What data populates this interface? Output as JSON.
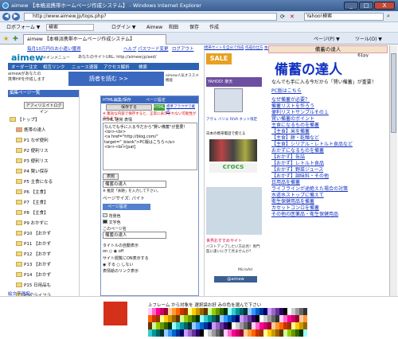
{
  "window": {
    "title": "aimew 【本格派携帯ホームページ作成システム】 - Windows Internet Explorer",
    "minimize": "_",
    "maximize": "□",
    "close": "X"
  },
  "address": {
    "url": "http://www.aimew.jp/tops.php?",
    "search_placeholder": "Yahoo!検索"
  },
  "favorites": {
    "items": [
      "ロボフォーム ▼",
      "検索",
      "ログイン ▼",
      "Aimew",
      "和田",
      "保存",
      "作成"
    ]
  },
  "tab": {
    "label": "aimew 【本格派携帯ホームページ作成システム】",
    "commands": [
      "ページ(P) ▼",
      "ツール(O) ▼"
    ]
  },
  "left": {
    "top_link": "毎月10万円のお小遣い獲得",
    "header_links": [
      "ヘルプ",
      "パスワード変更",
      "ログアウト"
    ],
    "account_label": "あなたのサイトURL: http://aimew.jp/aed/",
    "logo": "aimew",
    "logo_sub": "メインメニュー",
    "nav": [
      "オーダー注文",
      "相互リンク",
      "ニュース速報",
      "アクセス解析",
      "検索"
    ],
    "promo_lines": [
      "aimewがあなたの",
      "携帯HPを作成します"
    ],
    "promo_main": "読者を読む >>",
    "promo_tag": "aimew人気オススメ機能",
    "sidebar_title": "編集ページ一覧",
    "affiliate_button": "アフィリエイトログイン",
    "tree": [
      "【トップ】",
      "携帯の達人",
      "P1 なぜ便利",
      "P2 便利リス",
      "P3 便利リス",
      "P4 賢い保存",
      "P5 主食になる",
      "P6 【主食】",
      "P7 【主食】",
      "P8 【主食】",
      "P9 おかずに",
      "P10 【おかず",
      "P11 【おかず",
      "P12 【おかず",
      "P13 【おかず",
      "P14 【おかず",
      "P15 日用品も",
      "P16 ライフラ"
    ],
    "footer_link": "絵文字選択へ"
  },
  "editor": {
    "tabs": [
      "HTML編集/保存",
      "ページ設定",
      "ページ"
    ],
    "save_button": "保存する",
    "html_toggle": "HTML",
    "preview_btn": "標準ブラウザで確認",
    "warning": "※ 無効な内容で保存すると、正常に表示されない可能性があります。",
    "radio_label": "HTML 通常 表情",
    "content": "なんでも手に入る今だから\"賢い備蓄\"が重要！\n<br><br>\n<a href=\"http://blog.com/\" target=\"_blank\">PC版はこちら</a>\n<br><br>[pat]",
    "title_label": "表題",
    "title_value": "備蓄の達人",
    "note": "※ 推奨「表題」を入力して下さい。",
    "size_label": "ページサイズ: バイト",
    "settings_header": "ページ設定",
    "bg_label": "背景色",
    "text_label": "文字色",
    "page_title_label": "このページ名",
    "page_title_value": "備蓄の達人",
    "auto_title_label": "タイトルの自動表示",
    "on": "on",
    "off": "off",
    "return_label": "サイト閲覧にON表示する",
    "yes": "する",
    "no": "しない",
    "emoji_label": "表情絵のリンク表示"
  },
  "right": {
    "header_links": [
      "携帯サイトを自分で作成",
      "作成の仕方",
      "本格的なサイトを",
      "ショッピングサイト",
      "携帯サイト作るならアイミュー"
    ],
    "sale": "SALE",
    "yahoo": "YAHOO! 楽天",
    "ad1": "アヴェ バリエ RIVA ネット限定",
    "ad2": "日本の携帯電話で使える",
    "crocs": "crocs",
    "ad3": "世界おすすめサイト",
    "ad4": "バストアップしたい方必見！専門医に逢いにきて見ませんか？",
    "ad_footer": "MicroAd",
    "ad_bottom": "@aimew",
    "site_header": "備蓄の達人",
    "site_sub": "61py",
    "site_title": "備蓄の達人",
    "tagline": "なんでも手に入る今だから「賢い備蓄」が重要！",
    "pc_link": "PC版はこちら",
    "menu": [
      "なぜ備蓄が必要？",
      "備蓄リストを作ろう",
      "便利リストサンプルその１",
      "賢い備蓄のポイント",
      "主食になるものを備蓄",
      "【主食】米を備蓄",
      "【主食】餅・乾麺など",
      "【主食】シリアル・レトルト食品など",
      "おかずになるものを備蓄",
      "【おかず】缶詰",
      "【おかず】レトルト食品",
      "【おかず】野菜ジュース",
      "【おかず】調味料・その他",
      "日用品を備蓄",
      "ライフラインが途絶えた場合の対策",
      "水道水ストップに備えて",
      "衛生保健用品を備蓄",
      "カセットコンロを備蓄",
      "その他の医薬品・衛生保健用品"
    ]
  },
  "bottom": {
    "instruction": "上フレーム から対象を 選択袋お好 みの色を選んで下さい",
    "swatch_color": "#d4301a"
  }
}
